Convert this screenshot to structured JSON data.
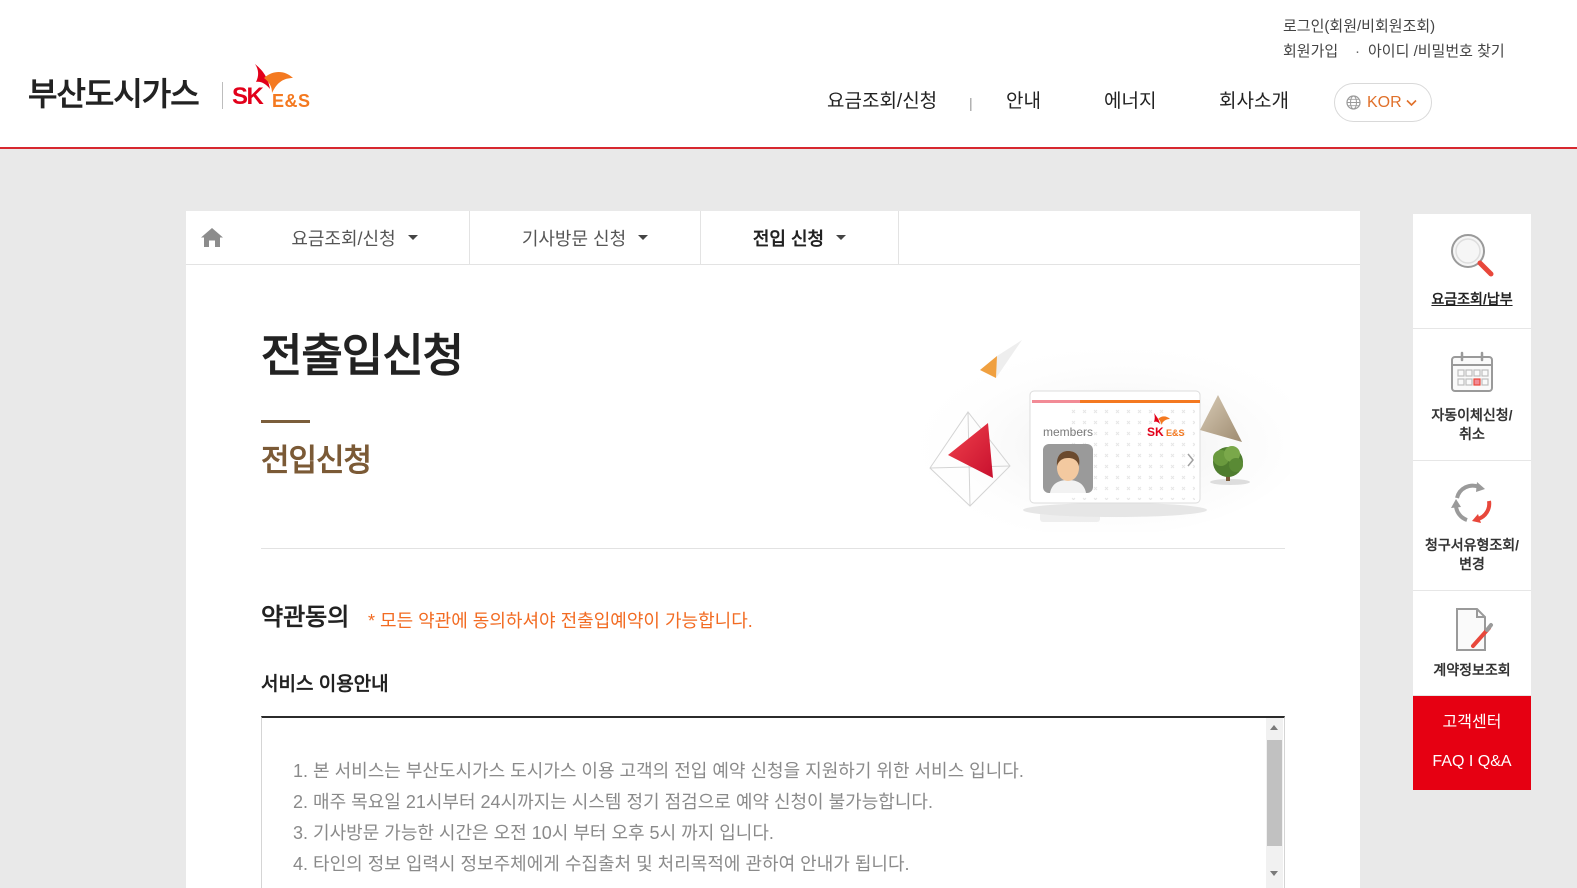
{
  "header": {
    "logo_text": "부산도시가스",
    "brand_sk": "SK",
    "brand_es": "E&S",
    "util": {
      "login": "로그인(회원/비회원조회)",
      "join": "회원가입",
      "dot": "·",
      "find": "아이디 /비밀번호 찾기"
    },
    "nav": [
      {
        "label": "요금조회/신청"
      },
      {
        "label": "안내"
      },
      {
        "label": "에너지"
      },
      {
        "label": "회사소개"
      }
    ],
    "nav_separator": "|",
    "lang": {
      "label": "KOR",
      "icon": "globe-icon",
      "caret": "chevron-down-icon"
    }
  },
  "subnav": {
    "home_icon": "home-icon",
    "items": [
      {
        "label": "요금조회/신청",
        "active": false
      },
      {
        "label": "기사방문 신청",
        "active": false
      },
      {
        "label": "전입 신청",
        "active": true
      }
    ]
  },
  "page": {
    "title": "전출입신청",
    "subtitle": "전입신청"
  },
  "illustration": {
    "card_label": "members",
    "brand_sk": "SK",
    "brand_es": "E&S"
  },
  "terms": {
    "heading": "약관동의",
    "notice": "* 모든 약관에 동의하셔야 전출입예약이 가능합니다.",
    "service_title": "서비스 이용안내",
    "lines": [
      "1. 본 서비스는 부산도시가스 도시가스 이용 고객의 전입 예약 신청을 지원하기 위한 서비스 입니다.",
      "2. 매주 목요일 21시부터 24시까지는 시스템 정기 점검으로 예약 신청이 불가능합니다.",
      "3. 기사방문 가능한 시간은 오전 10시 부터 오후 5시 까지 입니다.",
      "4. 타인의 정보 입력시 정보주체에게 수집출처 및 처리목적에 관하여 안내가 됩니다."
    ]
  },
  "quick_menu": {
    "items": [
      {
        "icon": "magnifier-icon",
        "lines": [
          "요금조회/납부"
        ]
      },
      {
        "icon": "calendar-icon",
        "lines": [
          "자동이체신청/",
          "취소"
        ]
      },
      {
        "icon": "refresh-icon",
        "lines": [
          "청구서유형조회/",
          "변경"
        ]
      },
      {
        "icon": "document-icon",
        "lines": [
          "계약정보조회"
        ]
      }
    ],
    "customer_center": {
      "title": "고객센터",
      "links": "FAQ I Q&A"
    }
  },
  "colors": {
    "header_rule": "#d7282f",
    "brand_red": "#e2001a",
    "brand_orange": "#f47920",
    "notice_orange": "#f26b22",
    "subtitle_brown": "#7b5a36",
    "customer_center_red": "#e60012",
    "page_bg": "#e9e9e9"
  }
}
